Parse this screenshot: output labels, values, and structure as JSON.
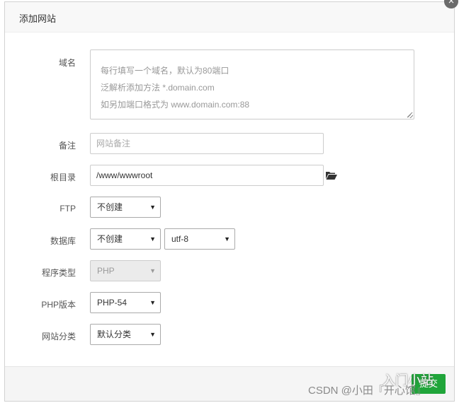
{
  "dialog": {
    "title": "添加网站",
    "close_icon": "close-icon"
  },
  "form": {
    "domain": {
      "label": "域名",
      "placeholder_lines": [
        "每行填写一个域名，默认为80端口",
        "泛解析添加方法 *.domain.com",
        "如另加端口格式为 www.domain.com:88"
      ]
    },
    "remark": {
      "label": "备注",
      "placeholder": "网站备注"
    },
    "root_dir": {
      "label": "根目录",
      "value": "/www/wwwroot",
      "icon": "folder-open-icon"
    },
    "ftp": {
      "label": "FTP",
      "selected": "不创建"
    },
    "database": {
      "label": "数据库",
      "selected": "不创建",
      "charset_selected": "utf-8"
    },
    "program_type": {
      "label": "程序类型",
      "selected": "PHP"
    },
    "php_version": {
      "label": "PHP版本",
      "selected": "PHP-54"
    },
    "site_category": {
      "label": "网站分类",
      "selected": "默认分类"
    }
  },
  "footer": {
    "submit_label": "提交"
  },
  "watermark": {
    "text": "CSDN @小田『开心馆』",
    "logo_text": "入门小站"
  },
  "colors": {
    "accent": "#20a53a",
    "close_bg": "#6b6b6b"
  }
}
